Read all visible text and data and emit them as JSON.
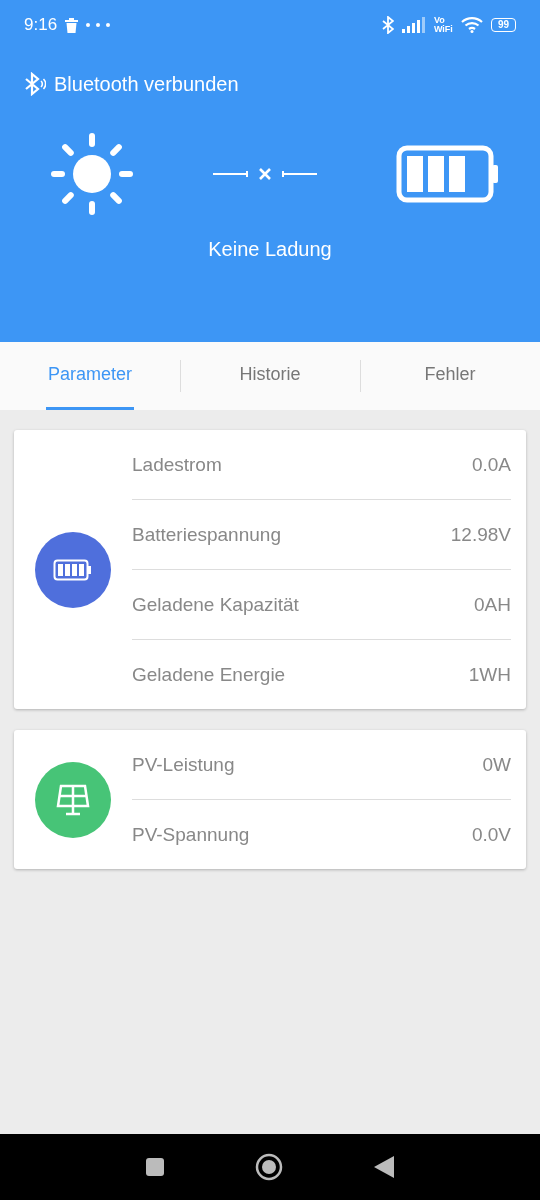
{
  "status_bar": {
    "time": "9:16",
    "volte": [
      "Vo",
      "WiFi"
    ],
    "battery": "99"
  },
  "header": {
    "connection": "Bluetooth verbunden",
    "charge_state": "Keine Ladung"
  },
  "tabs": [
    {
      "label": "Parameter",
      "selected": true
    },
    {
      "label": "Historie",
      "selected": false
    },
    {
      "label": "Fehler",
      "selected": false
    }
  ],
  "cards": [
    {
      "kind": "battery",
      "color": "#4f6fdc",
      "rows": [
        {
          "label": "Ladestrom",
          "value": "0.0A"
        },
        {
          "label": "Batteriespannung",
          "value": "12.98V"
        },
        {
          "label": "Geladene Kapazität",
          "value": "0AH"
        },
        {
          "label": "Geladene Energie",
          "value": "1WH"
        }
      ]
    },
    {
      "kind": "solar",
      "color": "#47c477",
      "rows": [
        {
          "label": "PV-Leistung",
          "value": "0W"
        },
        {
          "label": "PV-Spannung",
          "value": "0.0V"
        }
      ]
    }
  ]
}
